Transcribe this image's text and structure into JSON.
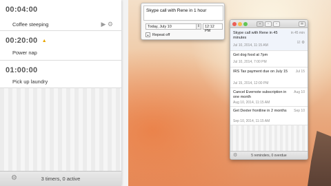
{
  "timers": {
    "items": [
      {
        "time": "00:04:00",
        "label": "Coffee steeping",
        "play_icon": "play-icon",
        "settings_icon": "gear-icon"
      },
      {
        "time": "00:20:00",
        "label": "Power nap",
        "alarm_icon": "alarm-icon"
      },
      {
        "time": "01:00:00",
        "label": "Pick up laundry"
      }
    ],
    "status": "3 timers, 0 active"
  },
  "quick_entry": {
    "text": "Skype call with Rene in 1 hour",
    "date": "Today, July 10",
    "time": "12:12 PM",
    "repeat": "Repeat off"
  },
  "reminders": {
    "items": [
      {
        "title": "Skype call with Rene in 45 minutes",
        "meta": "Jul 10, 2014, 11:15 AM",
        "when": "in 45 min"
      },
      {
        "title": "Get dog food at 7pm",
        "meta": "Jul 10, 2014, 7:00 PM",
        "when": ""
      },
      {
        "title": "IRS Tax payment due on July 15",
        "meta": "Jul 15, 2014, 12:00 PM",
        "when": "Jul 15"
      },
      {
        "title": "Cancel Evernote subscription in one month",
        "meta": "Aug 10, 2014, 11:15 AM",
        "when": "Aug 10"
      },
      {
        "title": "Get Dexter frontline in 2 months",
        "meta": "Sep 10, 2014, 11:15 AM",
        "when": "Sep 10"
      }
    ],
    "status": "5 reminders, 0 overdue"
  }
}
